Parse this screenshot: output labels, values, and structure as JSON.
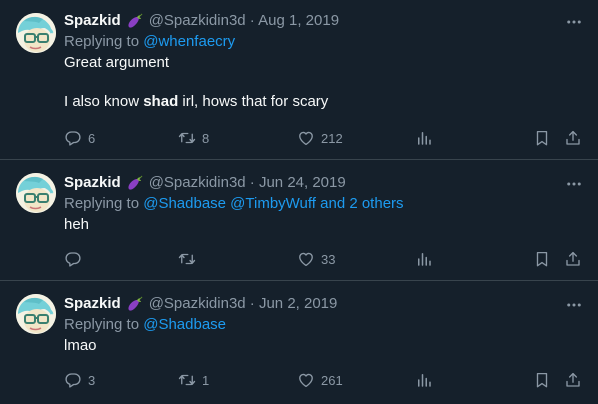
{
  "icons": {
    "more": "more-horizontal-icon",
    "reply": "reply-bubble-icon",
    "retweet": "retweet-icon",
    "like": "heart-icon",
    "views": "bar-chart-icon",
    "bookmark": "bookmark-icon",
    "share": "share-upload-icon"
  },
  "colors": {
    "background": "#15202b",
    "link": "#1d9bf0",
    "muted": "#8b98a5",
    "divider": "#38444d",
    "emoji": "#8a3fc4"
  },
  "tweets": [
    {
      "name": "Spazkid",
      "handle_date": "@Spazkidin3d · Aug 1, 2019",
      "replying_prefix": "Replying to",
      "replying_to": "@whenfaecry",
      "line1": "Great argument",
      "line2_pre": "I also know ",
      "line2_bold": "shad",
      "line2_post": " irl, hows that for scary",
      "replies": "6",
      "retweets": "8",
      "likes": "212"
    },
    {
      "name": "Spazkid",
      "handle_date": "@Spazkidin3d · Jun 24, 2019",
      "replying_prefix": "Replying to",
      "replying_to": "@Shadbase @TimbyWuff and 2 others",
      "line1": "heh",
      "replies": "",
      "retweets": "",
      "likes": "33"
    },
    {
      "name": "Spazkid",
      "handle_date": "@Spazkidin3d · Jun 2, 2019",
      "replying_prefix": "Replying to",
      "replying_to": "@Shadbase",
      "line1": "lmao",
      "replies": "3",
      "retweets": "1",
      "likes": "261"
    }
  ]
}
